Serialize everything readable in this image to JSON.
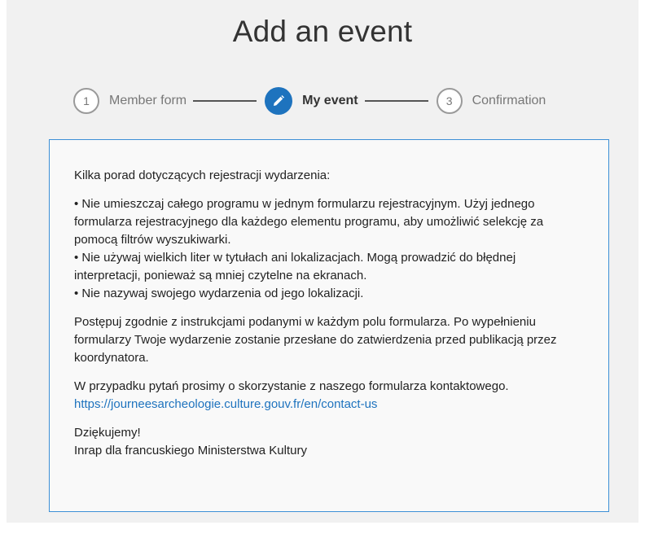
{
  "page": {
    "title": "Add an event"
  },
  "stepper": {
    "steps": [
      {
        "number": "1",
        "label": "Member form",
        "state": "inactive"
      },
      {
        "number": "",
        "label": "My event",
        "state": "active",
        "icon": "pencil-icon"
      },
      {
        "number": "3",
        "label": "Confirmation",
        "state": "inactive"
      }
    ]
  },
  "content": {
    "intro": "Kilka porad dotyczących rejestracji wydarzenia:",
    "tips": [
      "• Nie umieszczaj całego programu w jednym formularzu rejestracyjnym. Użyj jednego formularza rejestracyjnego dla każdego elementu programu, aby umożliwić selekcję za pomocą filtrów wyszukiwarki.",
      "• Nie używaj wielkich liter w tytułach ani lokalizacjach. Mogą prowadzić do błędnej interpretacji, ponieważ są mniej czytelne na ekranach.",
      "• Nie nazywaj swojego wydarzenia od jego lokalizacji."
    ],
    "instructions": "Postępuj zgodnie z instrukcjami podanymi w każdym polu formularza. Po wypełnieniu formularzy Twoje wydarzenie zostanie przesłane do zatwierdzenia przed publikacją przez koordynatora.",
    "contact_text": "W przypadku pytań prosimy o skorzystanie z naszego formularza kontaktowego.",
    "contact_link": "https://journeesarcheologie.culture.gouv.fr/en/contact-us",
    "thanks": "Dziękujemy!",
    "signature": "Inrap dla francuskiego Ministerstwa Kultury"
  },
  "colors": {
    "accent": "#1e73be",
    "box_border": "#3c8fd6",
    "background": "#f1f1f1"
  }
}
